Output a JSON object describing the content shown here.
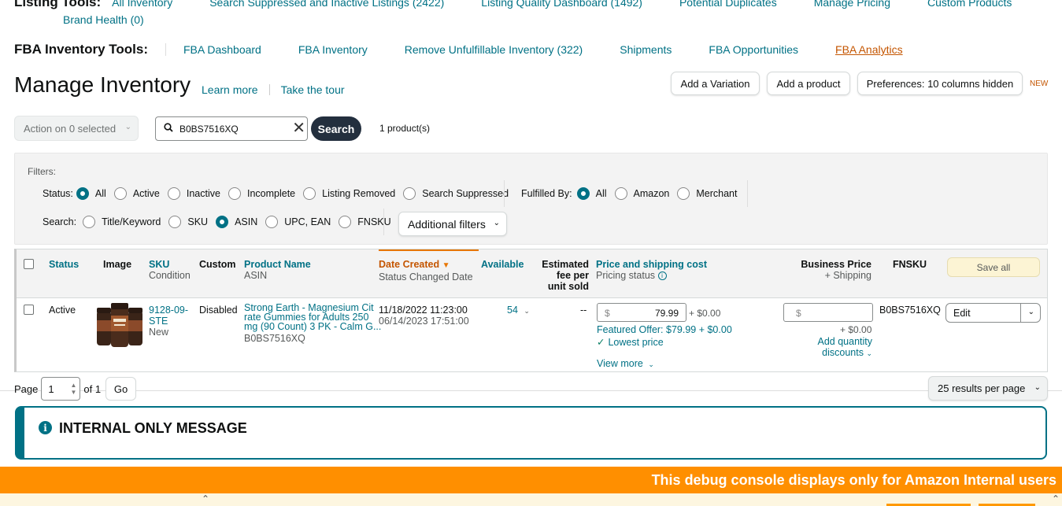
{
  "listing_tools": {
    "label": "Listing Tools:",
    "links": [
      "All Inventory",
      "Search Suppressed and Inactive Listings (2422)",
      "Listing Quality Dashboard (1492)",
      "Potential Duplicates",
      "Manage Pricing",
      "Custom Products"
    ],
    "brand_health": "Brand Health (0)"
  },
  "fba_tools": {
    "label": "FBA Inventory Tools:",
    "links": [
      "FBA Dashboard",
      "FBA Inventory",
      "Remove Unfulfillable Inventory (322)",
      "Shipments",
      "FBA Opportunities",
      "FBA Analytics"
    ]
  },
  "header": {
    "title": "Manage Inventory",
    "learn_more": "Learn more",
    "tour": "Take the tour",
    "add_variation": "Add a Variation",
    "add_product": "Add a product",
    "preferences": "Preferences: 10 columns hidden",
    "new_badge": "NEW"
  },
  "toolbar": {
    "action": "Action on 0 selected",
    "search_value": "B0BS7516XQ",
    "search_button": "Search",
    "count": "1 product(s)"
  },
  "filters": {
    "label": "Filters:",
    "status_label": "Status:",
    "status_options": [
      "All",
      "Active",
      "Inactive",
      "Incomplete",
      "Listing Removed",
      "Search Suppressed"
    ],
    "fulfilled_label": "Fulfilled By:",
    "fulfilled_options": [
      "All",
      "Amazon",
      "Merchant"
    ],
    "search_label": "Search:",
    "search_options": [
      "Title/Keyword",
      "SKU",
      "ASIN",
      "UPC, EAN",
      "FNSKU"
    ],
    "additional": "Additional filters"
  },
  "table": {
    "headers": {
      "status": "Status",
      "image": "Image",
      "sku": "SKU",
      "condition": "Condition",
      "custom": "Custom",
      "product_name": "Product Name",
      "asin": "ASIN",
      "date_created": "Date Created",
      "status_changed": "Status Changed Date",
      "available": "Available",
      "fee1": "Estimated",
      "fee2": "fee per",
      "fee3": "unit sold",
      "price": "Price and shipping cost",
      "pricing_status": "Pricing status",
      "business_price": "Business Price",
      "shipping": "+ Shipping",
      "fnsku": "FNSKU",
      "save_all": "Save all"
    },
    "row": {
      "status": "Active",
      "sku1": "9128-09-",
      "sku2": "STE",
      "condition": "New",
      "custom": "Disabled",
      "name1": "Strong Earth - Magnesium Cit",
      "name2": "rate Gummies for Adults 250",
      "name3": "mg (90 Count) 3 PK - Calm G...",
      "asin": "B0BS7516XQ",
      "date_created": "11/18/2022 11:23:00",
      "status_changed": "06/14/2023 17:51:00",
      "available": "54",
      "fee": "--",
      "currency": "$",
      "price": "79.99",
      "shipping": "+ $0.00",
      "featured_offer": "Featured Offer: $79.99 + $0.00",
      "lowest_price": "Lowest price",
      "view_more": "View more",
      "biz_currency": "$",
      "biz_shipping": "+ $0.00",
      "quantity_discounts1": "Add quantity",
      "quantity_discounts2": "discounts",
      "fnsku": "B0BS7516XQ",
      "edit": "Edit"
    }
  },
  "pager": {
    "page_label": "Page",
    "page_value": "1",
    "of": "of 1",
    "go": "Go",
    "per_page": "25 results per page"
  },
  "internal_message": "INTERNAL ONLY MESSAGE",
  "debug_text": "This debug console displays only for Amazon Internal users",
  "colors": {
    "teal": "#007185",
    "orange": "#ff8f00",
    "active_link": "#c45500"
  }
}
